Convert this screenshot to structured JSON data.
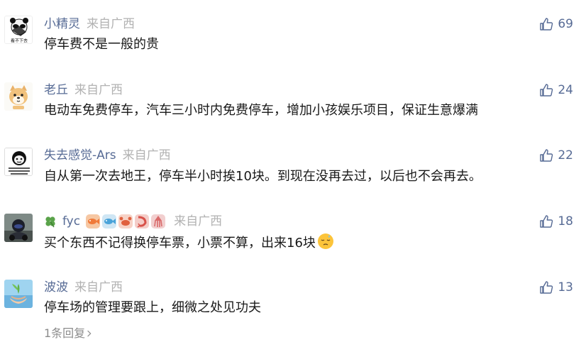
{
  "comments": [
    {
      "nickname": "小精灵",
      "location": "来自广西",
      "text": "停车费不是一般的贵",
      "likes": "69",
      "avatar_icon": "panda-meme-avatar",
      "avatar_text": "看不下去"
    },
    {
      "nickname": "老丘",
      "location": "来自广西",
      "text": "电动车免费停车，汽车三小时内免费停车，增加小孩娱乐项目，保证生意爆满",
      "likes": "24",
      "avatar_icon": "shiba-dog-avatar"
    },
    {
      "nickname": "失去感觉-Ars",
      "location": "来自广西",
      "text": "自从第一次去地王，停车半小时挨10块。到现在没再去过，以后也不会再去。",
      "likes": "22",
      "avatar_icon": "meme-face-avatar"
    },
    {
      "nickname": "fyc",
      "location": "来自广西",
      "text": "买个东西不记得换停车票，小票不算，出来16块",
      "likes": "18",
      "avatar_icon": "motorcycle-photo-avatar",
      "prefix_icon": "clover-icon",
      "emblems": [
        "fish-emblem",
        "fish-emblem",
        "crab-emblem",
        "shrimp-emblem",
        "squid-emblem"
      ],
      "trailing_emoji": "sleepy-face-emoji"
    },
    {
      "nickname": "波波",
      "location": "来自广西",
      "text": "停车场的管理要跟上，细微之处见功夫",
      "likes": "13",
      "avatar_icon": "hands-sprout-avatar"
    }
  ],
  "reply_link": "1条回复",
  "colors": {
    "nickname": "#576b95",
    "location": "#b2b2b2",
    "text": "#191919",
    "like": "#576b95"
  }
}
